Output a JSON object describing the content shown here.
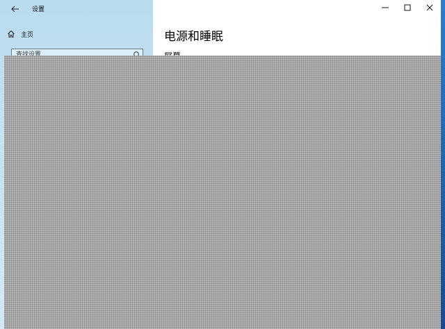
{
  "window": {
    "title": "设置"
  },
  "sidebar": {
    "home_label": "主页",
    "search": {
      "placeholder": "查找设置",
      "value": ""
    }
  },
  "main": {
    "page_title": "电源和睡眠",
    "section_title": "屏幕"
  },
  "icons": {
    "back": "arrow-left-icon",
    "home": "home-icon",
    "search": "search-icon",
    "minimize": "minimize-icon",
    "maximize": "maximize-icon",
    "close": "close-icon"
  },
  "colors": {
    "sidebar_bg": "#b9dcef",
    "content_bg": "#ffffff",
    "redaction": "#b4b4b4"
  }
}
